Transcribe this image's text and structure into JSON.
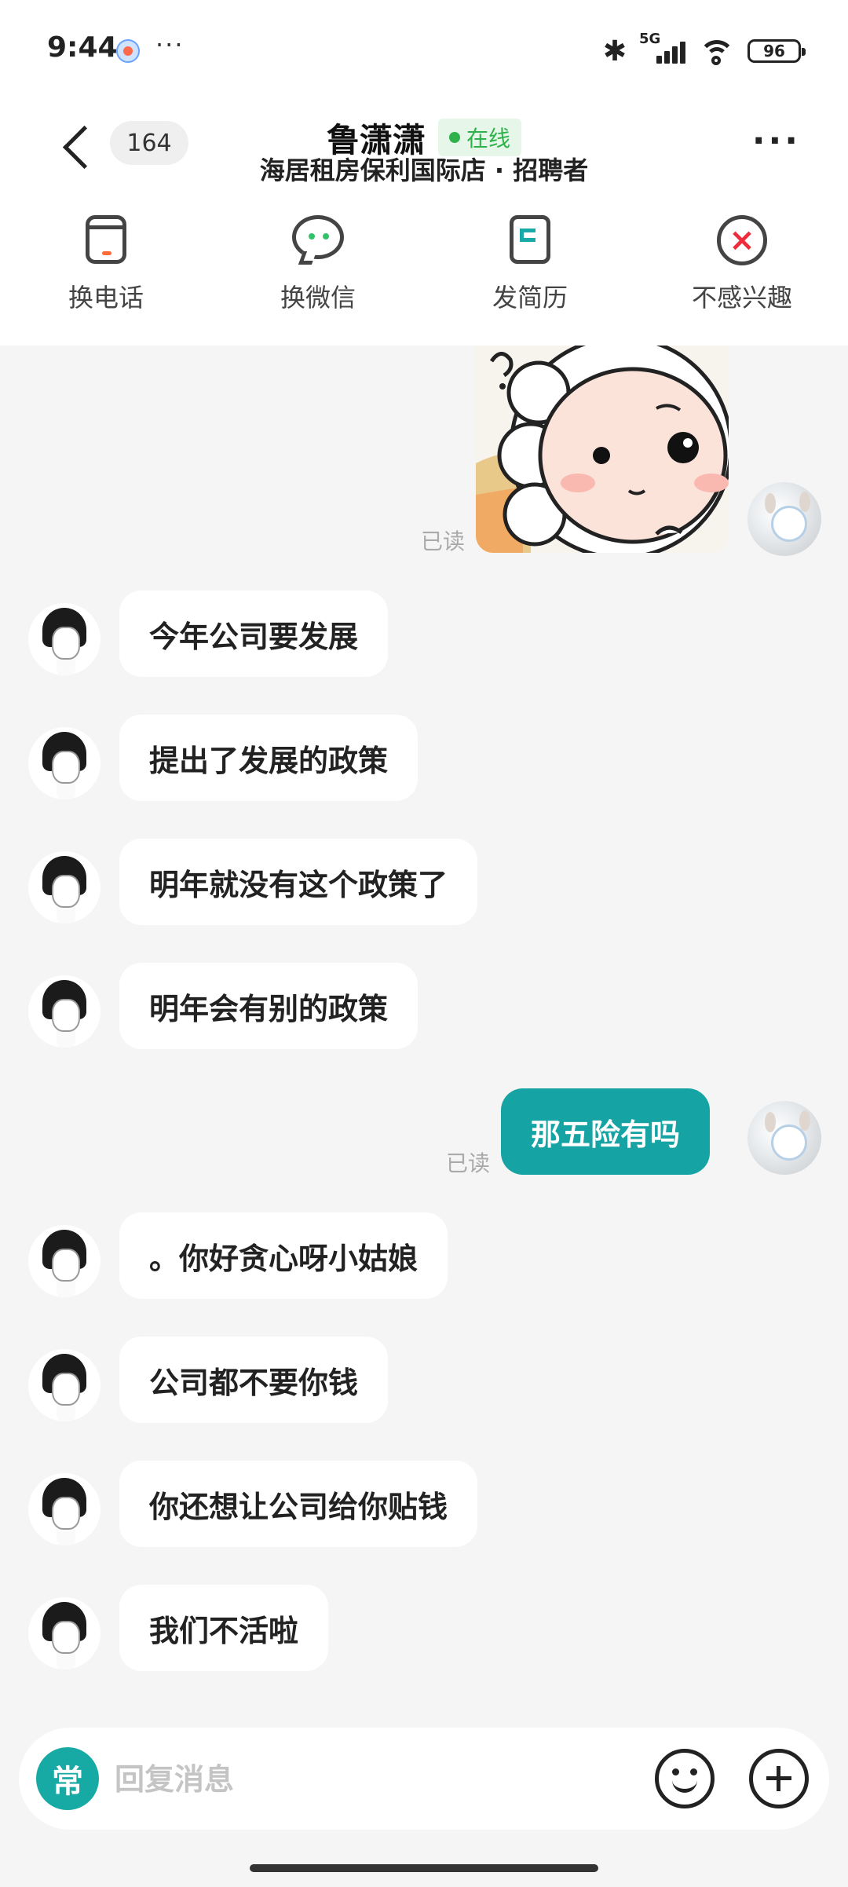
{
  "status_bar": {
    "time": "9:44",
    "more": "···",
    "network": "5G",
    "battery": "96"
  },
  "header": {
    "unread_count": "164",
    "contact_name": "鲁潇潇",
    "online_status": "在线",
    "subtitle": "海居租房保利国际店 · 招聘者",
    "more": "···"
  },
  "actions": [
    {
      "label": "换电话",
      "icon": "phone-icon"
    },
    {
      "label": "换微信",
      "icon": "wechat-icon"
    },
    {
      "label": "发简历",
      "icon": "resume-icon"
    },
    {
      "label": "不感兴趣",
      "icon": "not-interested-icon"
    }
  ],
  "chat": {
    "read_label": "已读",
    "messages": [
      {
        "from": "self",
        "type": "sticker"
      },
      {
        "from": "other",
        "text": "今年公司要发展"
      },
      {
        "from": "other",
        "text": "提出了发展的政策"
      },
      {
        "from": "other",
        "text": "明年就没有这个政策了"
      },
      {
        "from": "other",
        "text": "明年会有别的政策"
      },
      {
        "from": "self",
        "text": "那五险有吗"
      },
      {
        "from": "other",
        "text": "。你好贪心呀小姑娘"
      },
      {
        "from": "other",
        "text": "公司都不要你钱"
      },
      {
        "from": "other",
        "text": "你还想让公司给你贴钱"
      },
      {
        "from": "other",
        "text": "我们不活啦"
      }
    ]
  },
  "input": {
    "common_phrases": "常",
    "placeholder": "回复消息"
  },
  "colors": {
    "accent": "#16a3a3",
    "online": "#2fb24a",
    "background": "#f5f5f5"
  }
}
